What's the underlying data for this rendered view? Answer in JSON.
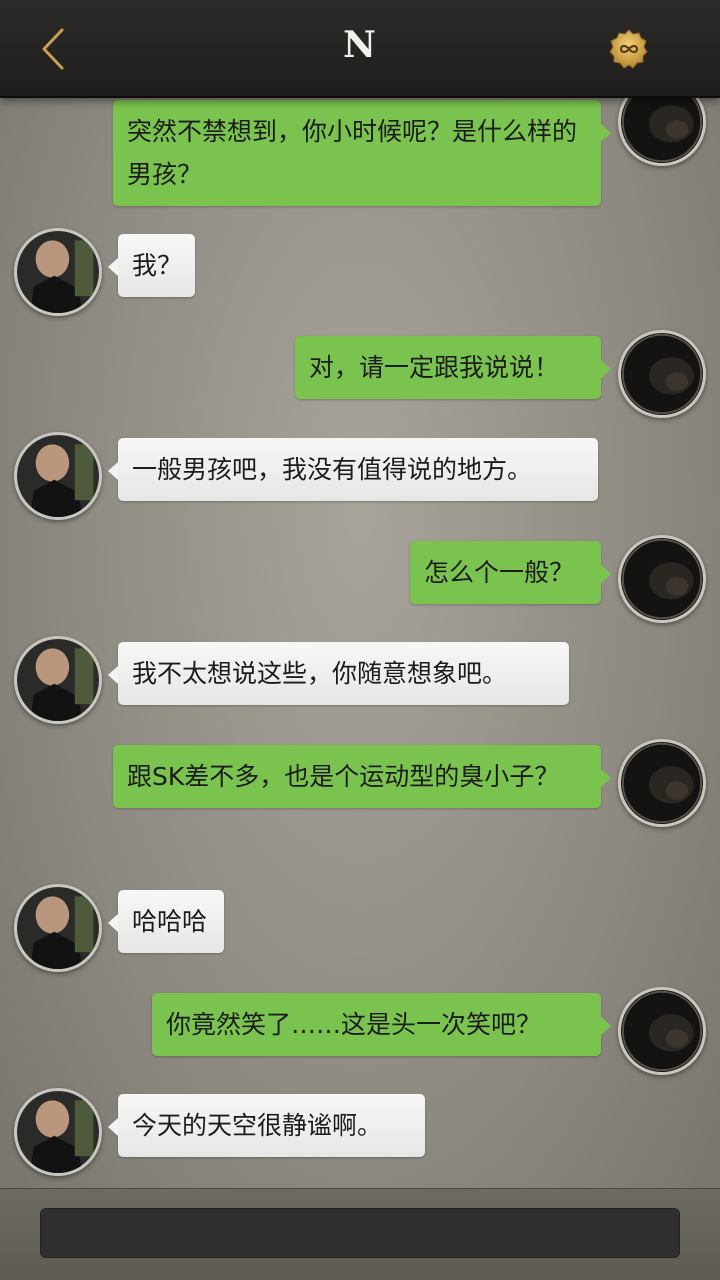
{
  "header": {
    "title": "N",
    "back_icon": "chevron-left-icon",
    "badge_icon": "infinity-badge-icon",
    "accent_color": "#c8a04f"
  },
  "messages": [
    {
      "sender": "me",
      "text": "突然不禁想到，你小时候呢？是什么样的男孩？"
    },
    {
      "sender": "them",
      "text": "我？"
    },
    {
      "sender": "me",
      "text": "对，请一定跟我说说！"
    },
    {
      "sender": "them",
      "text": "一般男孩吧，我没有值得说的地方。"
    },
    {
      "sender": "me",
      "text": "怎么个一般？"
    },
    {
      "sender": "them",
      "text": "我不太想说这些，你随意想象吧。"
    },
    {
      "sender": "me",
      "text": "跟SK差不多，也是个运动型的臭小子？"
    },
    {
      "sender": "them",
      "text": "哈哈哈"
    },
    {
      "sender": "me",
      "text": "你竟然笑了……这是头一次笑吧？"
    },
    {
      "sender": "them",
      "text": "今天的天空很静谧啊。"
    }
  ],
  "input": {
    "value": "",
    "placeholder": ""
  },
  "colors": {
    "my_bubble": "#7bc34f",
    "their_bubble": "#f3f3f2",
    "background": "#8f8b83"
  }
}
